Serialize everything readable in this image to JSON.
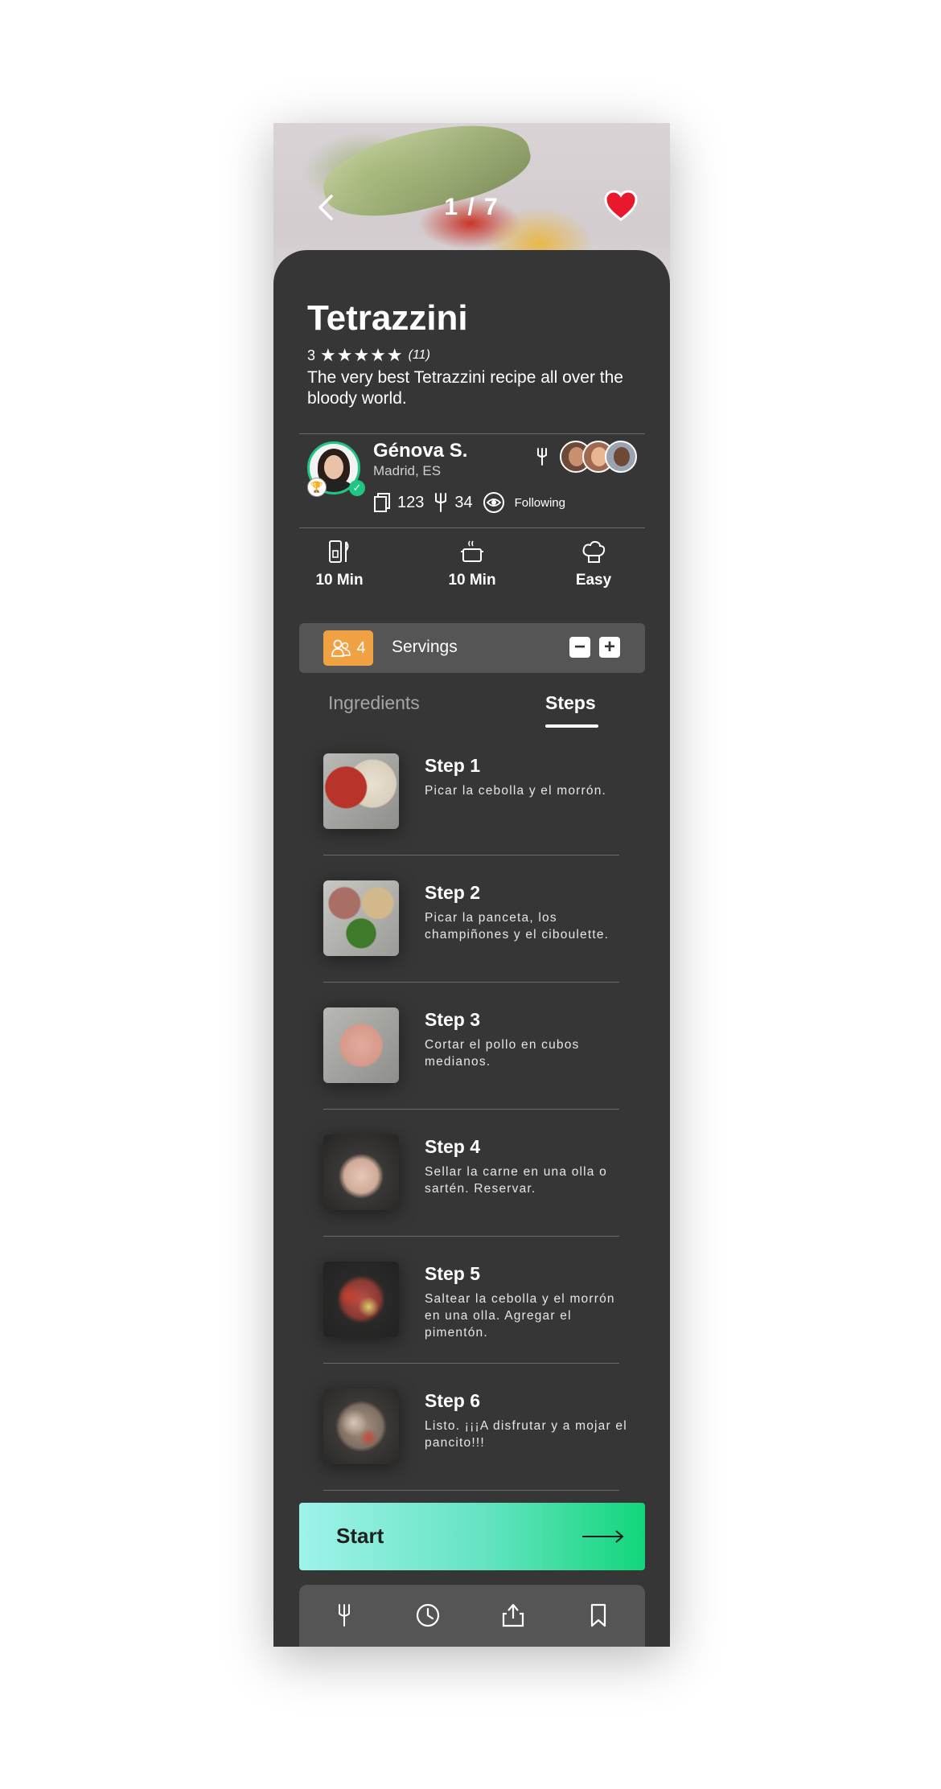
{
  "header": {
    "counter": "1 / 7",
    "icons": {
      "back": "chevron-left-icon",
      "favorite": "heart-icon"
    }
  },
  "recipe": {
    "title": "Tetrazzini",
    "rating_value": "3",
    "stars": "★★★★★",
    "rating_count": "(11)",
    "description": "The very best Tetrazzini recipe all over the bloody world."
  },
  "author": {
    "name": "Génova S.",
    "location": "Madrid, ES",
    "recipes_count": "123",
    "forks_count": "34",
    "following_label": "Following"
  },
  "meta": [
    {
      "icon": "prep-time-icon",
      "label": "10 Min"
    },
    {
      "icon": "cook-time-icon",
      "label": "10 Min"
    },
    {
      "icon": "chef-hat-icon",
      "label": "Easy"
    }
  ],
  "servings": {
    "count": "4",
    "label": "Servings",
    "minus": "−",
    "plus": "+"
  },
  "tabs": {
    "ingredients": "Ingredients",
    "steps": "Steps",
    "active": "steps"
  },
  "steps": [
    {
      "title": "Step 1",
      "text": "Picar la cebolla y el morrón."
    },
    {
      "title": "Step 2",
      "text": "Picar la panceta, los champiñones y el ciboulette."
    },
    {
      "title": "Step 3",
      "text": "Cortar el pollo en cubos medianos."
    },
    {
      "title": "Step 4",
      "text": "Sellar la carne en una olla o sartén. Reservar."
    },
    {
      "title": "Step 5",
      "text": "Saltear la cebolla y el morrón en una olla. Agregar el pimentón."
    },
    {
      "title": "Step 6",
      "text": "Listo. ¡¡¡A disfrutar y a mojar el pancito!!!"
    }
  ],
  "start": {
    "label": "Start"
  },
  "toolbar": {
    "icons": [
      "fork-icon",
      "clock-icon",
      "share-icon",
      "bookmark-icon"
    ]
  },
  "colors": {
    "background": "#363636",
    "panel": "#555555",
    "accent_orange": "#f0a142",
    "accent_green": "#1fc583",
    "heart_red": "#e8192c",
    "start_gradient_start": "#9ff3ea",
    "start_gradient_end": "#12d67a"
  }
}
